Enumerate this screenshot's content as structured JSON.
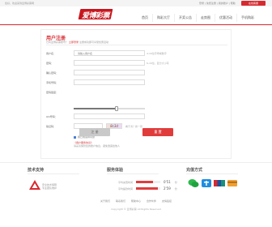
{
  "topbar": {
    "welcome": "您好，欢迎来到爱博彩票网",
    "links": "登录 | 免费注册 | 我的账户 | 帮助",
    "service_button": "在线客服"
  },
  "header": {
    "logo_text": "爱博彩票",
    "nav": [
      "首页",
      "购彩大厅",
      "开奖公告",
      "走势图",
      "优惠活动",
      "手机购彩"
    ]
  },
  "register": {
    "title": "用户注册",
    "subtitle_prefix": "已有爱博彩票账号？",
    "login_link": "立即登录",
    "subtitle_suffix": "注册成功即可享受优惠活动",
    "fields": [
      {
        "label": "用户名：",
        "placeholder": "请输入用户名",
        "hint": "4-16位字母或数字"
      },
      {
        "label": "密码：",
        "placeholder": "",
        "hint": "6-16位，区分大小写"
      },
      {
        "label": "确认密码：",
        "placeholder": "",
        "hint": ""
      },
      {
        "label": "手机号码：",
        "placeholder": "",
        "hint": ""
      },
      {
        "label": "密码强度：",
        "placeholder": "",
        "hint": ""
      },
      {
        "label": "QQ号码：",
        "placeholder": "",
        "hint": ""
      },
      {
        "label": "验证码：",
        "placeholder": "",
        "hint": "看不清？换一张"
      }
    ],
    "captcha_text": "8c3d",
    "password_strength": 0.6,
    "agree_text": "我已阅读并同意",
    "notice_line1": "《用户服务协议》",
    "notice_line2": "请妥善保管您的账户信息，避免泄露给他人",
    "register_button": "注 册",
    "reset_button": "重 置"
  },
  "footer": {
    "col1_title": "技术支持",
    "col1_text": [
      "安全技术保障",
      "专业团队维护"
    ],
    "col2_title": "服务体验",
    "col2_rows": [
      {
        "label": "平均充值时间",
        "value": "0'51",
        "unit": "秒",
        "ratio": 0.7
      },
      {
        "label": "平均提款时间",
        "value": "2'59",
        "unit": "秒",
        "ratio": 0.9
      }
    ],
    "col3_title": "充值方式",
    "bottom_links": [
      "关于我们",
      "联系我们",
      "帮助中心",
      "合作伙伴",
      "友情链接"
    ],
    "copyright": "Copyright © 爱博彩票 All Rights Reserved"
  },
  "colors": {
    "accent": "#d7292f",
    "button_gray": "#c9c9c9",
    "button_red": "#e03c3c"
  }
}
